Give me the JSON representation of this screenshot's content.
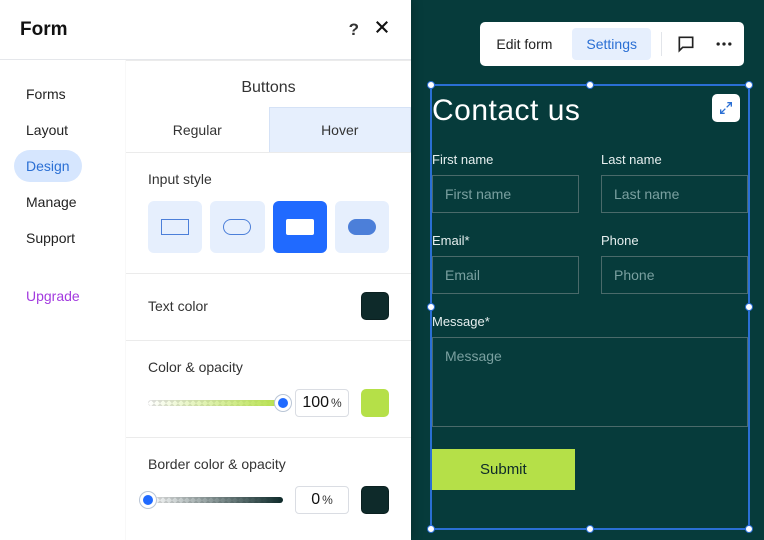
{
  "panel": {
    "title": "Form",
    "sidebar": {
      "items": [
        "Forms",
        "Layout",
        "Design",
        "Manage",
        "Support"
      ],
      "active_index": 2,
      "upgrade": "Upgrade"
    },
    "buttons_section_title": "Buttons",
    "tabs": {
      "regular": "Regular",
      "hover": "Hover"
    },
    "input_style": {
      "title": "Input style"
    },
    "text_color": {
      "title": "Text color"
    },
    "color_opacity": {
      "title": "Color & opacity",
      "value": "100",
      "unit": "%"
    },
    "border_color_opacity": {
      "title": "Border color & opacity",
      "value": "0",
      "unit": "%"
    }
  },
  "topbar": {
    "edit": "Edit form",
    "settings": "Settings"
  },
  "form": {
    "title": "Contact us",
    "first_name": {
      "label": "First name",
      "placeholder": "First name"
    },
    "last_name": {
      "label": "Last name",
      "placeholder": "Last name"
    },
    "email": {
      "label": "Email*",
      "placeholder": "Email"
    },
    "phone": {
      "label": "Phone",
      "placeholder": "Phone"
    },
    "message": {
      "label": "Message*",
      "placeholder": "Message"
    },
    "submit": "Submit"
  },
  "colors": {
    "accent_blue": "#206aff",
    "lime": "#b5e048",
    "dark_teal": "#0e2a2a"
  }
}
